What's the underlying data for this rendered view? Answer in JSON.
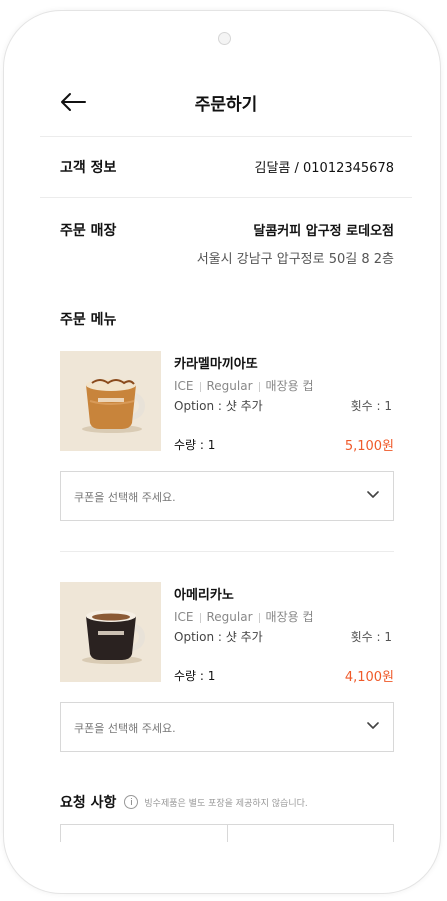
{
  "header": {
    "title": "주문하기",
    "back_icon": "arrow-left-icon"
  },
  "customer": {
    "label": "고객 정보",
    "value": "김달콤 / 01012345678"
  },
  "store": {
    "label": "주문 매장",
    "name": "달콤커피 압구정 로데오점",
    "address": "서울시 강남구 압구정로 50길 8 2층"
  },
  "menu": {
    "title": "주문 메뉴",
    "items": [
      {
        "name": "카라멜마끼아또",
        "temp": "ICE",
        "size": "Regular",
        "cup": "매장용 컵",
        "option": "Option :  샷 추가",
        "count": "횟수 :   1",
        "qty": "수량  :  1",
        "price": "5,100원",
        "coupon_placeholder": "쿠폰을 선택해 주세요."
      },
      {
        "name": "아메리카노",
        "temp": "ICE",
        "size": "Regular",
        "cup": "매장용 컵",
        "option": "Option :  샷 추가",
        "count": "횟수 :   1",
        "qty": "수량  :  1",
        "price": "4,100원",
        "coupon_placeholder": "쿠폰을 선택해 주세요."
      }
    ]
  },
  "request": {
    "label": "요청 사항",
    "note": "빙수제품은 별도 포장을 제공하지 않습니다.",
    "info_icon": "i"
  },
  "colors": {
    "price": "#ef5a2a",
    "border": "#d8d8d8"
  }
}
